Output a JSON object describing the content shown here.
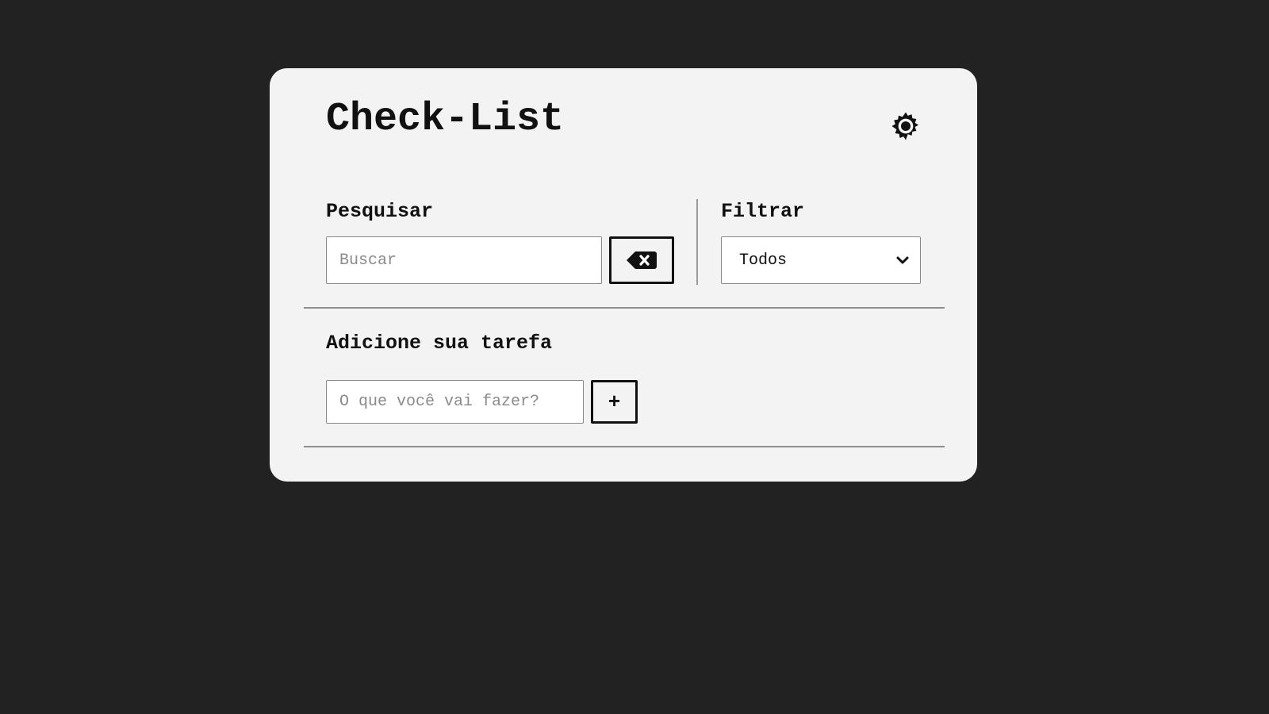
{
  "app": {
    "title": "Check-List",
    "settings_icon": "gear-icon"
  },
  "search": {
    "label": "Pesquisar",
    "placeholder": "Buscar",
    "value": "",
    "erase_icon": "backspace-icon"
  },
  "filter": {
    "label": "Filtrar",
    "selected": "Todos",
    "icon": "chevron-down-icon"
  },
  "add_task": {
    "label": "Adicione sua tarefa",
    "placeholder": "O que você vai fazer?",
    "value": "",
    "button_label": "+"
  },
  "colors": {
    "background": "#222222",
    "card": "#f3f3f3",
    "text": "#111111"
  }
}
